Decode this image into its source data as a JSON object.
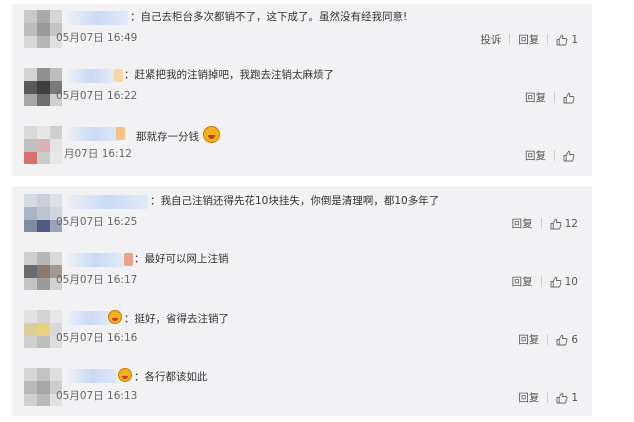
{
  "labels": {
    "report": "投诉",
    "reply": "回复"
  },
  "colors": {
    "panel_background": "#f2f2f5",
    "text": "#333333",
    "timestamp": "#666666"
  },
  "icons": {
    "like": "thumbs-up-outline-icon",
    "emoji": "laughing-face-emoji-icon"
  },
  "comments": [
    {
      "separator": "：",
      "text": "自己去柜台多次都销不了，这下成了。虽然没有经我同意!",
      "timestamp": "05月07日 16:49",
      "like_count": "1"
    },
    {
      "separator": "：",
      "text": "赶紧把我的注销掉吧，我跑去注销太麻烦了",
      "timestamp": "05月07日 16:22",
      "like_count": ""
    },
    {
      "separator": "",
      "text": "那就存一分钱",
      "timestamp": "月07日 16:12",
      "like_count": ""
    },
    {
      "separator": "：",
      "text": "我自己注销还得先花10块挂失，你倒是清理啊，都10多年了",
      "timestamp": "05月07日 16:25",
      "like_count": "12"
    },
    {
      "separator": "：",
      "text": "最好可以网上注销",
      "timestamp": "05月07日 16:17",
      "like_count": "10"
    },
    {
      "separator": "：",
      "text": "挺好，省得去注销了",
      "timestamp": "05月07日 16:16",
      "like_count": "6"
    },
    {
      "separator": "：",
      "text": "各行都该如此",
      "timestamp": "05月07日 16:13",
      "like_count": "1"
    }
  ]
}
